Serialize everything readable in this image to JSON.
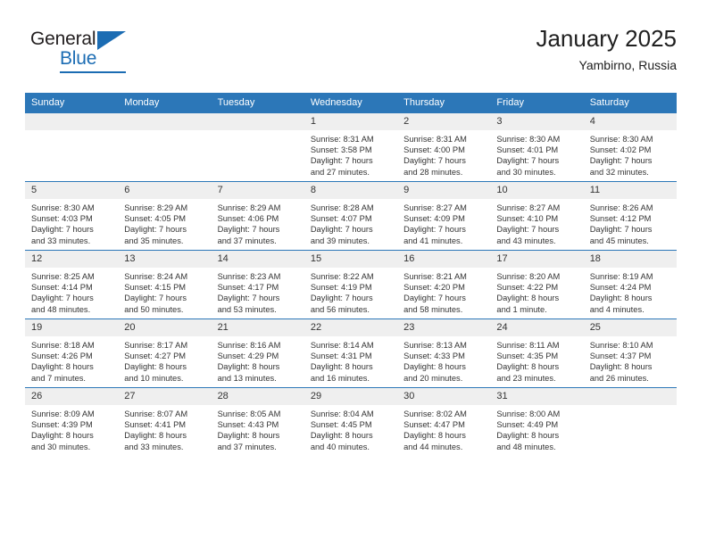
{
  "brand": {
    "name_part1": "General",
    "name_part2": "Blue",
    "accent_color": "#1b6cb3"
  },
  "header": {
    "title": "January 2025",
    "subtitle": "Yambirno, Russia"
  },
  "theme": {
    "header_bg": "#2c77b8",
    "daynum_bg": "#efefef",
    "text_color": "#333333"
  },
  "weekdays": [
    "Sunday",
    "Monday",
    "Tuesday",
    "Wednesday",
    "Thursday",
    "Friday",
    "Saturday"
  ],
  "labels": {
    "sunrise": "Sunrise:",
    "sunset": "Sunset:",
    "daylight": "Daylight:"
  },
  "weeks": [
    [
      {
        "day": "",
        "empty": true
      },
      {
        "day": "",
        "empty": true
      },
      {
        "day": "",
        "empty": true
      },
      {
        "day": "1",
        "sunrise": "Sunrise: 8:31 AM",
        "sunset": "Sunset: 3:58 PM",
        "daylight_1": "Daylight: 7 hours",
        "daylight_2": "and 27 minutes."
      },
      {
        "day": "2",
        "sunrise": "Sunrise: 8:31 AM",
        "sunset": "Sunset: 4:00 PM",
        "daylight_1": "Daylight: 7 hours",
        "daylight_2": "and 28 minutes."
      },
      {
        "day": "3",
        "sunrise": "Sunrise: 8:30 AM",
        "sunset": "Sunset: 4:01 PM",
        "daylight_1": "Daylight: 7 hours",
        "daylight_2": "and 30 minutes."
      },
      {
        "day": "4",
        "sunrise": "Sunrise: 8:30 AM",
        "sunset": "Sunset: 4:02 PM",
        "daylight_1": "Daylight: 7 hours",
        "daylight_2": "and 32 minutes."
      }
    ],
    [
      {
        "day": "5",
        "sunrise": "Sunrise: 8:30 AM",
        "sunset": "Sunset: 4:03 PM",
        "daylight_1": "Daylight: 7 hours",
        "daylight_2": "and 33 minutes."
      },
      {
        "day": "6",
        "sunrise": "Sunrise: 8:29 AM",
        "sunset": "Sunset: 4:05 PM",
        "daylight_1": "Daylight: 7 hours",
        "daylight_2": "and 35 minutes."
      },
      {
        "day": "7",
        "sunrise": "Sunrise: 8:29 AM",
        "sunset": "Sunset: 4:06 PM",
        "daylight_1": "Daylight: 7 hours",
        "daylight_2": "and 37 minutes."
      },
      {
        "day": "8",
        "sunrise": "Sunrise: 8:28 AM",
        "sunset": "Sunset: 4:07 PM",
        "daylight_1": "Daylight: 7 hours",
        "daylight_2": "and 39 minutes."
      },
      {
        "day": "9",
        "sunrise": "Sunrise: 8:27 AM",
        "sunset": "Sunset: 4:09 PM",
        "daylight_1": "Daylight: 7 hours",
        "daylight_2": "and 41 minutes."
      },
      {
        "day": "10",
        "sunrise": "Sunrise: 8:27 AM",
        "sunset": "Sunset: 4:10 PM",
        "daylight_1": "Daylight: 7 hours",
        "daylight_2": "and 43 minutes."
      },
      {
        "day": "11",
        "sunrise": "Sunrise: 8:26 AM",
        "sunset": "Sunset: 4:12 PM",
        "daylight_1": "Daylight: 7 hours",
        "daylight_2": "and 45 minutes."
      }
    ],
    [
      {
        "day": "12",
        "sunrise": "Sunrise: 8:25 AM",
        "sunset": "Sunset: 4:14 PM",
        "daylight_1": "Daylight: 7 hours",
        "daylight_2": "and 48 minutes."
      },
      {
        "day": "13",
        "sunrise": "Sunrise: 8:24 AM",
        "sunset": "Sunset: 4:15 PM",
        "daylight_1": "Daylight: 7 hours",
        "daylight_2": "and 50 minutes."
      },
      {
        "day": "14",
        "sunrise": "Sunrise: 8:23 AM",
        "sunset": "Sunset: 4:17 PM",
        "daylight_1": "Daylight: 7 hours",
        "daylight_2": "and 53 minutes."
      },
      {
        "day": "15",
        "sunrise": "Sunrise: 8:22 AM",
        "sunset": "Sunset: 4:19 PM",
        "daylight_1": "Daylight: 7 hours",
        "daylight_2": "and 56 minutes."
      },
      {
        "day": "16",
        "sunrise": "Sunrise: 8:21 AM",
        "sunset": "Sunset: 4:20 PM",
        "daylight_1": "Daylight: 7 hours",
        "daylight_2": "and 58 minutes."
      },
      {
        "day": "17",
        "sunrise": "Sunrise: 8:20 AM",
        "sunset": "Sunset: 4:22 PM",
        "daylight_1": "Daylight: 8 hours",
        "daylight_2": "and 1 minute."
      },
      {
        "day": "18",
        "sunrise": "Sunrise: 8:19 AM",
        "sunset": "Sunset: 4:24 PM",
        "daylight_1": "Daylight: 8 hours",
        "daylight_2": "and 4 minutes."
      }
    ],
    [
      {
        "day": "19",
        "sunrise": "Sunrise: 8:18 AM",
        "sunset": "Sunset: 4:26 PM",
        "daylight_1": "Daylight: 8 hours",
        "daylight_2": "and 7 minutes."
      },
      {
        "day": "20",
        "sunrise": "Sunrise: 8:17 AM",
        "sunset": "Sunset: 4:27 PM",
        "daylight_1": "Daylight: 8 hours",
        "daylight_2": "and 10 minutes."
      },
      {
        "day": "21",
        "sunrise": "Sunrise: 8:16 AM",
        "sunset": "Sunset: 4:29 PM",
        "daylight_1": "Daylight: 8 hours",
        "daylight_2": "and 13 minutes."
      },
      {
        "day": "22",
        "sunrise": "Sunrise: 8:14 AM",
        "sunset": "Sunset: 4:31 PM",
        "daylight_1": "Daylight: 8 hours",
        "daylight_2": "and 16 minutes."
      },
      {
        "day": "23",
        "sunrise": "Sunrise: 8:13 AM",
        "sunset": "Sunset: 4:33 PM",
        "daylight_1": "Daylight: 8 hours",
        "daylight_2": "and 20 minutes."
      },
      {
        "day": "24",
        "sunrise": "Sunrise: 8:11 AM",
        "sunset": "Sunset: 4:35 PM",
        "daylight_1": "Daylight: 8 hours",
        "daylight_2": "and 23 minutes."
      },
      {
        "day": "25",
        "sunrise": "Sunrise: 8:10 AM",
        "sunset": "Sunset: 4:37 PM",
        "daylight_1": "Daylight: 8 hours",
        "daylight_2": "and 26 minutes."
      }
    ],
    [
      {
        "day": "26",
        "sunrise": "Sunrise: 8:09 AM",
        "sunset": "Sunset: 4:39 PM",
        "daylight_1": "Daylight: 8 hours",
        "daylight_2": "and 30 minutes."
      },
      {
        "day": "27",
        "sunrise": "Sunrise: 8:07 AM",
        "sunset": "Sunset: 4:41 PM",
        "daylight_1": "Daylight: 8 hours",
        "daylight_2": "and 33 minutes."
      },
      {
        "day": "28",
        "sunrise": "Sunrise: 8:05 AM",
        "sunset": "Sunset: 4:43 PM",
        "daylight_1": "Daylight: 8 hours",
        "daylight_2": "and 37 minutes."
      },
      {
        "day": "29",
        "sunrise": "Sunrise: 8:04 AM",
        "sunset": "Sunset: 4:45 PM",
        "daylight_1": "Daylight: 8 hours",
        "daylight_2": "and 40 minutes."
      },
      {
        "day": "30",
        "sunrise": "Sunrise: 8:02 AM",
        "sunset": "Sunset: 4:47 PM",
        "daylight_1": "Daylight: 8 hours",
        "daylight_2": "and 44 minutes."
      },
      {
        "day": "31",
        "sunrise": "Sunrise: 8:00 AM",
        "sunset": "Sunset: 4:49 PM",
        "daylight_1": "Daylight: 8 hours",
        "daylight_2": "and 48 minutes."
      },
      {
        "day": "",
        "empty": true
      }
    ]
  ]
}
